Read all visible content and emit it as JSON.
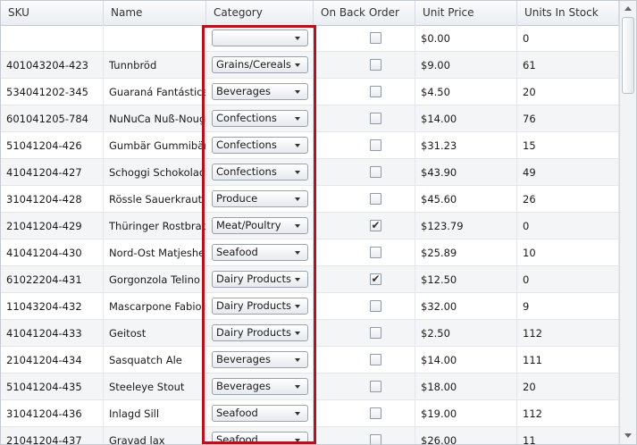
{
  "columns": [
    "SKU",
    "Name",
    "Category",
    "On Back Order",
    "Unit Price",
    "Units In Stock"
  ],
  "rows": [
    {
      "sku": "",
      "name": "",
      "category": "",
      "back_order": false,
      "price": "$0.00",
      "stock": "0"
    },
    {
      "sku": "401043204-423",
      "name": "Tunnbröd",
      "category": "Grains/Cereals",
      "back_order": false,
      "price": "$9.00",
      "stock": "61"
    },
    {
      "sku": "534041202-345",
      "name": "Guaraná Fantástica",
      "category": "Beverages",
      "back_order": false,
      "price": "$4.50",
      "stock": "20"
    },
    {
      "sku": "601041205-784",
      "name": "NuNuCa Nuß-Nougat",
      "category": "Confections",
      "back_order": false,
      "price": "$14.00",
      "stock": "76"
    },
    {
      "sku": "51041204-426",
      "name": "Gumbär Gummibärchen",
      "category": "Confections",
      "back_order": false,
      "price": "$31.23",
      "stock": "15"
    },
    {
      "sku": "41041204-427",
      "name": "Schoggi Schokolade",
      "category": "Confections",
      "back_order": false,
      "price": "$43.90",
      "stock": "49"
    },
    {
      "sku": "31041204-428",
      "name": "Rössle Sauerkraut",
      "category": "Produce",
      "back_order": false,
      "price": "$45.60",
      "stock": "26"
    },
    {
      "sku": "21041204-429",
      "name": "Thüringer Rostbratwurst",
      "category": "Meat/Poultry",
      "back_order": true,
      "price": "$123.79",
      "stock": "0"
    },
    {
      "sku": "41041204-430",
      "name": "Nord-Ost Matjeshering",
      "category": "Seafood",
      "back_order": false,
      "price": "$25.89",
      "stock": "10"
    },
    {
      "sku": "61022204-431",
      "name": "Gorgonzola Telino",
      "category": "Dairy Products",
      "back_order": true,
      "price": "$12.50",
      "stock": "0"
    },
    {
      "sku": "11043204-432",
      "name": "Mascarpone Fabioli",
      "category": "Dairy Products",
      "back_order": false,
      "price": "$32.00",
      "stock": "9"
    },
    {
      "sku": "41041204-433",
      "name": "Geitost",
      "category": "Dairy Products",
      "back_order": false,
      "price": "$2.50",
      "stock": "112"
    },
    {
      "sku": "21041204-434",
      "name": "Sasquatch Ale",
      "category": "Beverages",
      "back_order": false,
      "price": "$14.00",
      "stock": "111"
    },
    {
      "sku": "51041204-435",
      "name": "Steeleye Stout",
      "category": "Beverages",
      "back_order": false,
      "price": "$18.00",
      "stock": "20"
    },
    {
      "sku": "31041204-436",
      "name": "Inlagd Sill",
      "category": "Seafood",
      "back_order": false,
      "price": "$19.00",
      "stock": "112"
    },
    {
      "sku": "21041204-437",
      "name": "Gravad lax",
      "category": "Seafood",
      "back_order": false,
      "price": "$26.00",
      "stock": "11"
    }
  ],
  "colors": {
    "highlight": "#b1141e",
    "row_alt": "#f4f5f7",
    "border": "#c4c9d0"
  }
}
